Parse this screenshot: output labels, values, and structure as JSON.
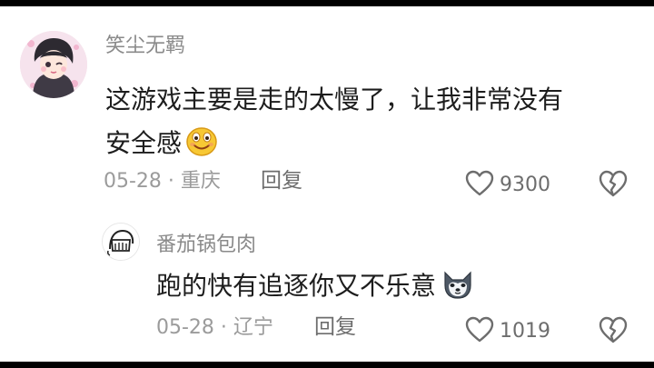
{
  "comments": [
    {
      "username": "笑尘无羁",
      "text_lines": [
        "这游戏主要是走的太慢了，让我非常没有",
        "安全感"
      ],
      "emoji": "grinning-emoji",
      "date": "05-28",
      "location": "重庆",
      "reply_label": "回复",
      "likes": "9300"
    },
    {
      "username": "番茄锅包肉",
      "text_lines": [
        "跑的快有追逐你又不乐意"
      ],
      "emoji": "husky-emoji",
      "date": "05-28",
      "location": "辽宁",
      "reply_label": "回复",
      "likes": "1019"
    }
  ],
  "meta_separator": " · ",
  "icons": {
    "like": "heart-outline-icon",
    "dislike": "broken-heart-outline-icon"
  },
  "colors": {
    "username": "#8a8a8a",
    "text": "#1d1d1d",
    "meta": "#9b9b9b",
    "action": "#6d6d6d",
    "background": "#ffffff"
  }
}
